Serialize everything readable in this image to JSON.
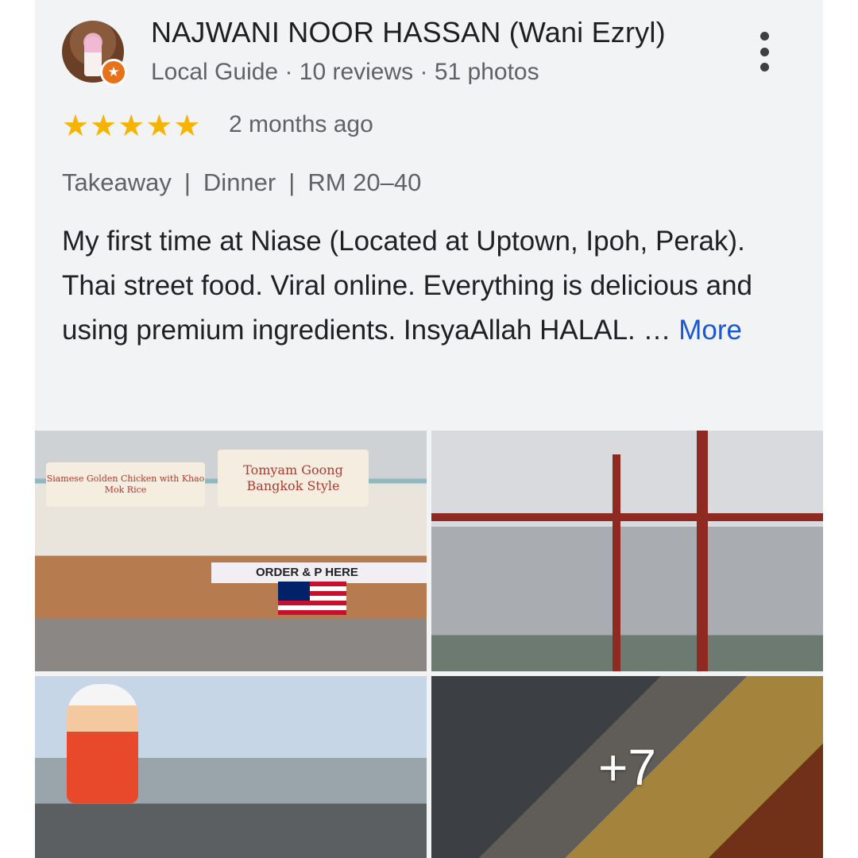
{
  "review": {
    "author_name": "NAJWANI NOOR HASSAN (Wani Ezryl)",
    "author_meta": "Local Guide · 10 reviews · 51 photos",
    "rating_stars": 5,
    "posted_ago": "2 months ago",
    "tags": [
      "Takeaway",
      "Dinner",
      "RM 20–40"
    ],
    "tag_separator": "|",
    "text": "My first time at Niase (Located at Uptown, Ipoh, Perak). Thai street food. Viral online. Everything is delicious and using premium ingredients. InsyaAllah HALAL. … ",
    "more_label": "More"
  },
  "photos": {
    "p1_sign_main": "Tomyam Goong Bangkok Style",
    "p1_sign_left": "Siamese Golden Chicken with Khao Mok Rice",
    "p1_counter": "ORDER & P    HERE",
    "extra_count": "+7"
  },
  "colors": {
    "card_bg": "#f2f3f5",
    "star": "#f6b400",
    "link": "#1a57d6",
    "local_guide_badge": "#e8711b"
  },
  "icons": {
    "menu": "more-vert-icon",
    "star": "star-icon",
    "badge": "local-guide-badge-icon"
  }
}
